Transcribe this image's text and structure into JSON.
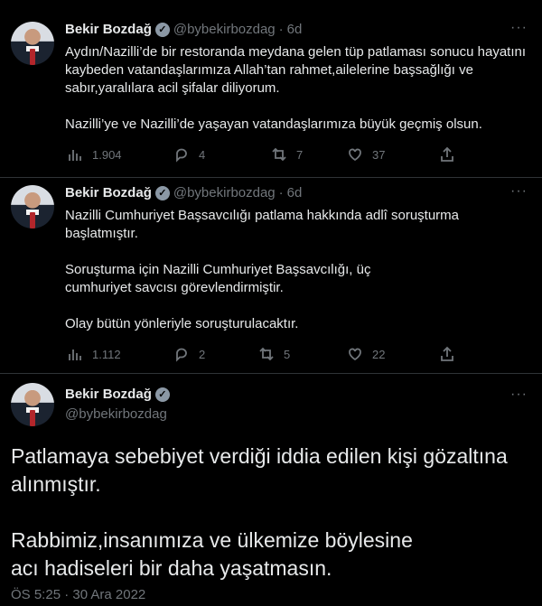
{
  "tweets": [
    {
      "name": "Bekir Bozdağ",
      "handle": "@bybekirbozdag",
      "dot": "·",
      "age": "6d",
      "more": "···",
      "paragraphs": [
        "Aydın/Nazilli’de bir restoranda meydana gelen tüp patlaması sonucu hayatını kaybeden vatandaşlarımıza Allah’tan rahmet,ailelerine başsağlığı ve sabır,yaralılara acil şifalar diliyorum.",
        "Nazilli’ye ve Nazilli’de yaşayan vatandaşlarımıza büyük geçmiş olsun."
      ],
      "views": "1.904",
      "replies": "4",
      "retweets": "7",
      "likes": "37"
    },
    {
      "name": "Bekir Bozdağ",
      "handle": "@bybekirbozdag",
      "dot": "·",
      "age": "6d",
      "more": "···",
      "paragraphs": [
        "Nazilli Cumhuriyet Başsavcılığı patlama hakkında adlî soruşturma başlatmıştır.",
        "Soruşturma için Nazilli Cumhuriyet Başsavcılığı, üç cumhuriyet savcısı görevlendirmiştir.",
        "Olay bütün yönleriyle soruşturulacaktır."
      ],
      "views": "1.112",
      "replies": "2",
      "retweets": "5",
      "likes": "22"
    }
  ],
  "main_tweet": {
    "name": "Bekir Bozdağ",
    "handle": "@bybekirbozdag",
    "more": "···",
    "paragraphs": [
      "Patlamaya sebebiyet verdiği iddia edilen kişi gözaltına alınmıştır.",
      "Rabbimiz,insanımıza ve ülkemize böylesine acı hadiseleri bir daha yaşatmasın."
    ],
    "timestamp": "ÖS 5:25 · 30 Ara 2022"
  },
  "colors": {
    "background": "#000000",
    "text": "#e7e9ea",
    "secondary": "#71767b",
    "divider": "#2f3336",
    "verified_badge": "#8b98a5"
  },
  "icons": [
    "verified-icon",
    "more-icon",
    "views-icon",
    "reply-icon",
    "retweet-icon",
    "like-icon",
    "share-icon"
  ]
}
